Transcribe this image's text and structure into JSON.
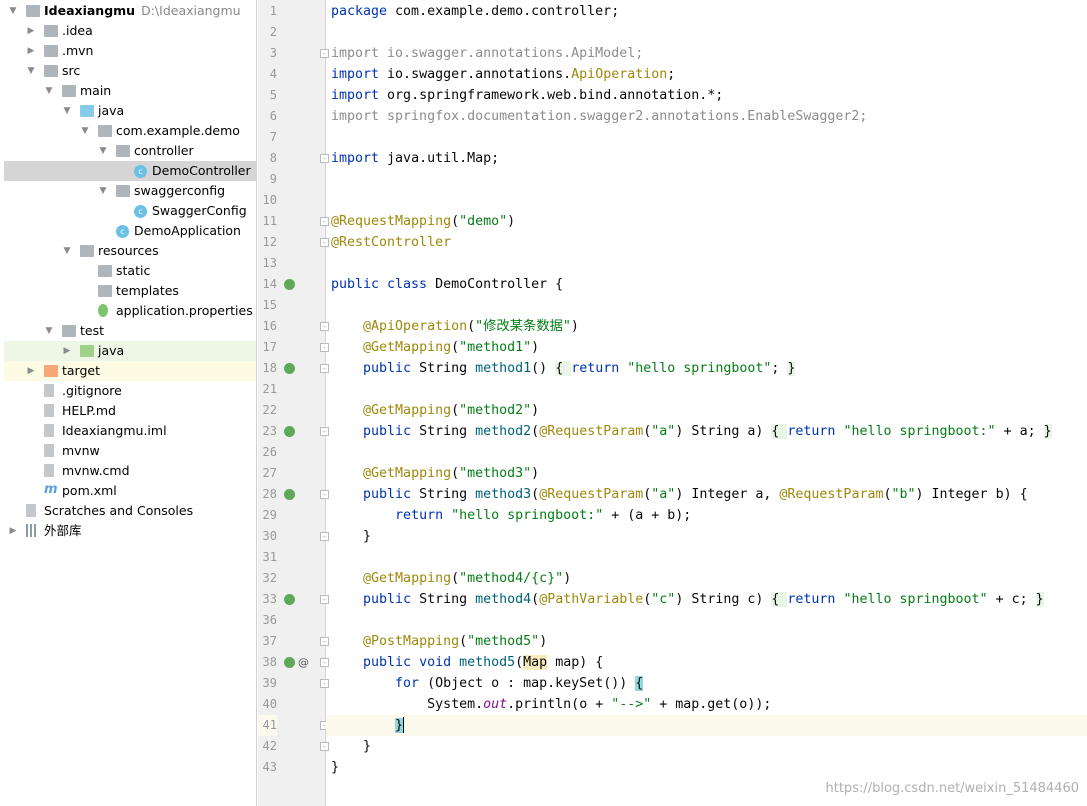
{
  "project_tree": [
    {
      "d": 0,
      "arrow": "open",
      "icon": "module-folder",
      "label": "Ideaxiangmu",
      "path": "D:\\Ideaxiangmu",
      "bold": true
    },
    {
      "d": 1,
      "arrow": "closed",
      "icon": "folder",
      "label": ".idea"
    },
    {
      "d": 1,
      "arrow": "closed",
      "icon": "folder",
      "label": ".mvn"
    },
    {
      "d": 1,
      "arrow": "open",
      "icon": "folder",
      "label": "src"
    },
    {
      "d": 2,
      "arrow": "open",
      "icon": "folder",
      "label": "main"
    },
    {
      "d": 3,
      "arrow": "open",
      "icon": "source-folder",
      "label": "java"
    },
    {
      "d": 4,
      "arrow": "open",
      "icon": "package",
      "label": "com.example.demo"
    },
    {
      "d": 5,
      "arrow": "open",
      "icon": "package",
      "label": "controller"
    },
    {
      "d": 6,
      "arrow": "",
      "icon": "class",
      "label": "DemoController",
      "state": "selected"
    },
    {
      "d": 5,
      "arrow": "open",
      "icon": "package",
      "label": "swaggerconfig"
    },
    {
      "d": 6,
      "arrow": "",
      "icon": "class",
      "label": "SwaggerConfig"
    },
    {
      "d": 5,
      "arrow": "",
      "icon": "spring-boot-class",
      "label": "DemoApplication"
    },
    {
      "d": 3,
      "arrow": "open",
      "icon": "resources-folder",
      "label": "resources"
    },
    {
      "d": 4,
      "arrow": "",
      "icon": "folder",
      "label": "static"
    },
    {
      "d": 4,
      "arrow": "",
      "icon": "folder",
      "label": "templates"
    },
    {
      "d": 4,
      "arrow": "",
      "icon": "spring-properties",
      "label": "application.properties"
    },
    {
      "d": 2,
      "arrow": "open",
      "icon": "folder",
      "label": "test"
    },
    {
      "d": 3,
      "arrow": "closed",
      "icon": "test-folder",
      "label": "java",
      "state": "test"
    },
    {
      "d": 1,
      "arrow": "closed",
      "icon": "excluded-folder",
      "label": "target",
      "state": "excluded"
    },
    {
      "d": 1,
      "arrow": "",
      "icon": "gitignore-file",
      "label": ".gitignore"
    },
    {
      "d": 1,
      "arrow": "",
      "icon": "markdown-file",
      "label": "HELP.md"
    },
    {
      "d": 1,
      "arrow": "",
      "icon": "iml-file",
      "label": "Ideaxiangmu.iml"
    },
    {
      "d": 1,
      "arrow": "",
      "icon": "shell-file",
      "label": "mvnw"
    },
    {
      "d": 1,
      "arrow": "",
      "icon": "text-file",
      "label": "mvnw.cmd"
    },
    {
      "d": 1,
      "arrow": "",
      "icon": "maven-file",
      "label": "pom.xml"
    },
    {
      "d": 0,
      "arrow": "",
      "icon": "scratches",
      "label": "Scratches and Consoles"
    },
    {
      "d": 0,
      "arrow": "closed",
      "icon": "library",
      "label": "外部库"
    }
  ],
  "editor": {
    "line_numbers": [
      1,
      2,
      3,
      4,
      5,
      6,
      7,
      8,
      9,
      10,
      11,
      12,
      13,
      14,
      15,
      16,
      17,
      18,
      21,
      22,
      23,
      26,
      27,
      28,
      29,
      30,
      31,
      32,
      33,
      36,
      37,
      38,
      39,
      40,
      41,
      42,
      43
    ],
    "current_line": 41,
    "gutter_web_icons": [
      14,
      18,
      23,
      28,
      33,
      38
    ],
    "gutter_at_icons": [
      38
    ],
    "fold_markers": [
      3,
      8,
      11,
      12,
      16,
      17,
      18,
      23,
      28,
      30,
      33,
      37,
      38,
      39,
      41,
      42
    ],
    "lines": [
      [
        [
          "package ",
          "k"
        ],
        [
          "com.example.demo.controller;",
          ""
        ]
      ],
      [],
      [
        [
          "import io.swagger.annotations.ApiModel;",
          "g"
        ]
      ],
      [
        [
          "import ",
          "k"
        ],
        [
          "io.swagger.annotations.",
          ""
        ],
        [
          "ApiOperation",
          "a"
        ],
        [
          ";",
          ""
        ]
      ],
      [
        [
          "import ",
          "k"
        ],
        [
          "org.springframework.web.bind.annotation.*;",
          ""
        ]
      ],
      [
        [
          "import springfox.documentation.swagger2.annotations.EnableSwagger2;",
          "g"
        ]
      ],
      [],
      [
        [
          "import ",
          "k"
        ],
        [
          "java.util.Map;",
          ""
        ]
      ],
      [],
      [],
      [
        [
          "@RequestMapping",
          "a"
        ],
        [
          "(",
          ""
        ],
        [
          "\"demo\"",
          "s"
        ],
        [
          ")",
          ""
        ]
      ],
      [
        [
          "@RestController",
          "a"
        ]
      ],
      [],
      [
        [
          "public class ",
          "k"
        ],
        [
          "DemoController {",
          ""
        ]
      ],
      [],
      [
        [
          "    ",
          ""
        ],
        [
          "@ApiOperation",
          "a"
        ],
        [
          "(",
          ""
        ],
        [
          "\"修改某条数据\"",
          "s"
        ],
        [
          ")",
          ""
        ]
      ],
      [
        [
          "    ",
          ""
        ],
        [
          "@GetMapping",
          "a"
        ],
        [
          "(",
          ""
        ],
        [
          "\"method1\"",
          "s"
        ],
        [
          ")",
          ""
        ]
      ],
      [
        [
          "    ",
          ""
        ],
        [
          "public ",
          "k"
        ],
        [
          "String ",
          ""
        ],
        [
          "method1",
          "mn"
        ],
        [
          "() ",
          ""
        ],
        [
          "{ ",
          "f"
        ],
        [
          "return ",
          "k"
        ],
        [
          "\"hello springboot\"",
          "s"
        ],
        [
          "; ",
          ""
        ],
        [
          "}",
          "f"
        ]
      ],
      [],
      [
        [
          "    ",
          ""
        ],
        [
          "@GetMapping",
          "a"
        ],
        [
          "(",
          ""
        ],
        [
          "\"method2\"",
          "s"
        ],
        [
          ")",
          ""
        ]
      ],
      [
        [
          "    ",
          ""
        ],
        [
          "public ",
          "k"
        ],
        [
          "String ",
          ""
        ],
        [
          "method2",
          "mn"
        ],
        [
          "(",
          ""
        ],
        [
          "@RequestParam",
          "a"
        ],
        [
          "(",
          ""
        ],
        [
          "\"a\"",
          "s"
        ],
        [
          ") String a) ",
          ""
        ],
        [
          "{ ",
          "f"
        ],
        [
          "return ",
          "k"
        ],
        [
          "\"hello springboot:\"",
          "s"
        ],
        [
          " + a; ",
          ""
        ],
        [
          "}",
          "f"
        ]
      ],
      [],
      [
        [
          "    ",
          ""
        ],
        [
          "@GetMapping",
          "a"
        ],
        [
          "(",
          ""
        ],
        [
          "\"method3\"",
          "s"
        ],
        [
          ")",
          ""
        ]
      ],
      [
        [
          "    ",
          ""
        ],
        [
          "public ",
          "k"
        ],
        [
          "String ",
          ""
        ],
        [
          "method3",
          "mn"
        ],
        [
          "(",
          ""
        ],
        [
          "@RequestParam",
          "a"
        ],
        [
          "(",
          ""
        ],
        [
          "\"a\"",
          "s"
        ],
        [
          ") Integer a, ",
          ""
        ],
        [
          "@RequestParam",
          "a"
        ],
        [
          "(",
          ""
        ],
        [
          "\"b\"",
          "s"
        ],
        [
          ") Integer b) {",
          ""
        ]
      ],
      [
        [
          "        ",
          ""
        ],
        [
          "return ",
          "k"
        ],
        [
          "\"hello springboot:\"",
          "s"
        ],
        [
          " + (a + b);",
          ""
        ]
      ],
      [
        [
          "    }",
          ""
        ]
      ],
      [],
      [
        [
          "    ",
          ""
        ],
        [
          "@GetMapping",
          "a"
        ],
        [
          "(",
          ""
        ],
        [
          "\"method4/{c}\"",
          "s"
        ],
        [
          ")",
          ""
        ]
      ],
      [
        [
          "    ",
          ""
        ],
        [
          "public ",
          "k"
        ],
        [
          "String ",
          ""
        ],
        [
          "method4",
          "mn"
        ],
        [
          "(",
          ""
        ],
        [
          "@PathVariable",
          "a"
        ],
        [
          "(",
          ""
        ],
        [
          "\"c\"",
          "s"
        ],
        [
          ") String c) ",
          ""
        ],
        [
          "{ ",
          "f"
        ],
        [
          "return ",
          "k"
        ],
        [
          "\"hello springboot\"",
          "s"
        ],
        [
          " + c; ",
          ""
        ],
        [
          "}",
          "f"
        ]
      ],
      [],
      [
        [
          "    ",
          ""
        ],
        [
          "@PostMapping",
          "a"
        ],
        [
          "(",
          ""
        ],
        [
          "\"method5\"",
          "s"
        ],
        [
          ")",
          ""
        ]
      ],
      [
        [
          "    ",
          ""
        ],
        [
          "public void ",
          "k"
        ],
        [
          "method5",
          "mn"
        ],
        [
          "(",
          ""
        ],
        [
          "Map",
          "m"
        ],
        [
          " map) {",
          ""
        ]
      ],
      [
        [
          "        ",
          ""
        ],
        [
          "for ",
          "k"
        ],
        [
          "(Object o : map.keySet()) ",
          ""
        ],
        [
          "{",
          "b"
        ]
      ],
      [
        [
          "            System.",
          ""
        ],
        [
          "out",
          "o"
        ],
        [
          ".println(o + ",
          ""
        ],
        [
          "\"-->\"",
          "s"
        ],
        [
          " + map.get(o));",
          ""
        ]
      ],
      [
        [
          "        ",
          ""
        ],
        [
          "}",
          "b"
        ]
      ],
      [
        [
          "    }",
          ""
        ]
      ],
      [
        [
          "}",
          ""
        ]
      ]
    ]
  },
  "watermark": "https://blog.csdn.net/weixin_51484460"
}
